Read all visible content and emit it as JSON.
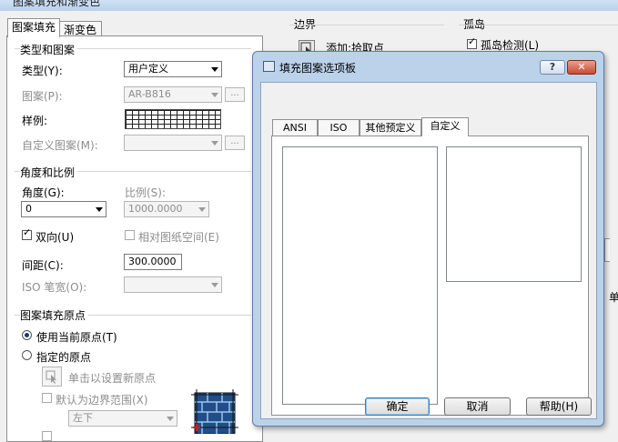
{
  "window": {
    "title": "图案填充和渐变色"
  },
  "tabs": [
    "图案填充",
    "渐变色"
  ],
  "type_pattern": {
    "group_title": "类型和图案",
    "type_label": "类型(Y):",
    "type_value": "用户定义",
    "pattern_label": "图案(P):",
    "pattern_value": "AR-B816",
    "swatch_label": "样例:",
    "custom_label": "自定义图案(M):",
    "custom_value": "",
    "dots": "..."
  },
  "angle_scale": {
    "group_title": "角度和比例",
    "angle_label": "角度(G):",
    "angle_value": "0",
    "scale_label": "比例(S):",
    "scale_value": "1000.0000",
    "double_label": "双向(U)",
    "double_checked": true,
    "relative_label": "相对图纸空间(E)",
    "relative_checked": false,
    "spacing_label": "间距(C):",
    "spacing_value": "300.0000",
    "iso_label": "ISO 笔宽(O):",
    "iso_value": ""
  },
  "origin": {
    "group_title": "图案填充原点",
    "use_current": "使用当前原点(T)",
    "specified": "指定的原点",
    "click_set": "单击以设置新原点",
    "default_extent": "默认为边界范围(X)",
    "position": "左下"
  },
  "boundary": {
    "title": "边界",
    "add_pick": "添加:拾取点"
  },
  "island": {
    "title": "孤岛",
    "detect": "孤岛检测(L)",
    "detect_checked": true
  },
  "right_clip": "单",
  "dialog": {
    "title": "填充图案选项板",
    "help": "?",
    "close": "✕",
    "tabs": [
      "ANSI",
      "ISO",
      "其他预定义",
      "自定义"
    ],
    "active_tab": "自定义",
    "ok": "确定",
    "cancel": "取消",
    "help_btn": "帮助(H)"
  }
}
